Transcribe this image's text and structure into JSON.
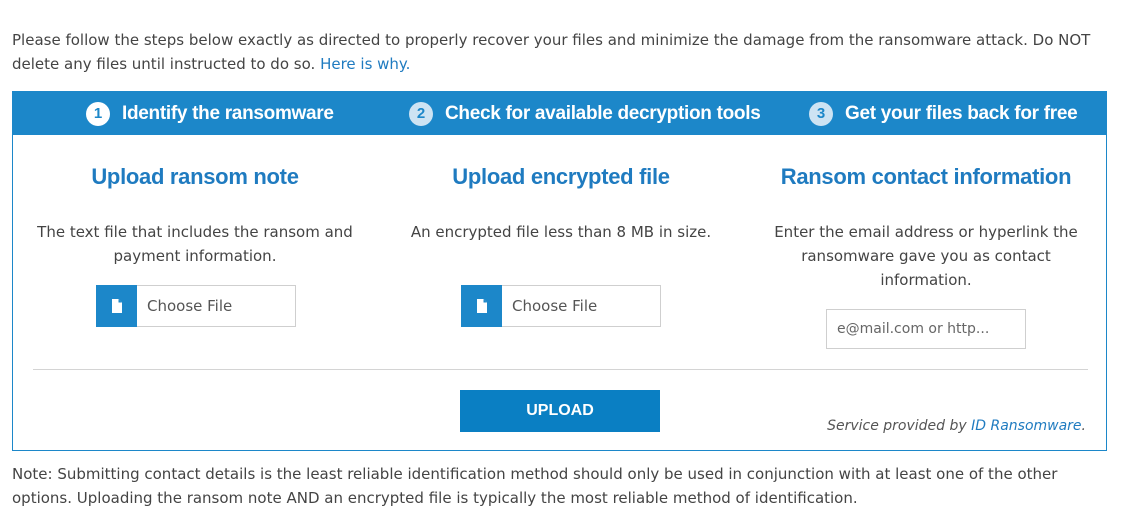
{
  "intro": {
    "text": "Please follow the steps below exactly as directed to properly recover your files and minimize the damage from the ransomware attack. Do NOT delete any files until instructed to do so.",
    "link": "Here is why."
  },
  "steps": [
    {
      "number": "1",
      "label": "Identify the ransomware"
    },
    {
      "number": "2",
      "label": "Check for available decryption tools"
    },
    {
      "number": "3",
      "label": "Get your files back for free"
    }
  ],
  "columns": {
    "note": {
      "title": "Upload ransom note",
      "description": "The text file that includes the ransom and payment information.",
      "button": "Choose File"
    },
    "file": {
      "title": "Upload encrypted file",
      "description": "An encrypted file less than 8 MB in size.",
      "button": "Choose File"
    },
    "contact": {
      "title": "Ransom contact information",
      "description": "Enter the email address or hyperlink the ransomware gave you as contact information.",
      "placeholder": "e@mail.com or http..."
    }
  },
  "upload_label": "UPLOAD",
  "service": {
    "prefix": "Service provided by",
    "link": "ID Ransomware",
    "suffix": "."
  },
  "note": "Note: Submitting contact details is the least reliable identification method should only be used in conjunction with at least one of the other options. Uploading the ransom note AND an encrypted file is typically the most reliable method of identification.",
  "colors": {
    "accent": "#1c87c9",
    "button": "#0a7fc3",
    "link": "#1f7bc0"
  },
  "icons": {
    "file": "file-icon"
  }
}
